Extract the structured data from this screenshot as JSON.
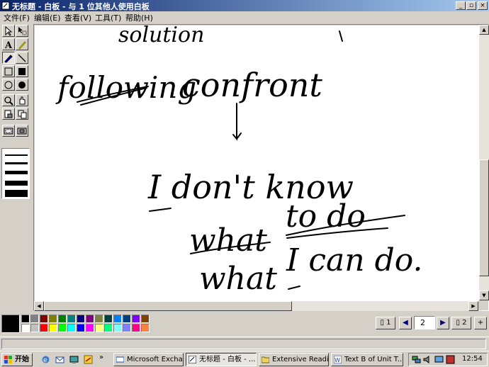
{
  "window": {
    "title": "无标题 - 白板 - 与 1 位其他人使用白板",
    "buttons": {
      "minimize": "_",
      "restore": "▫",
      "close": "×"
    }
  },
  "menu": [
    "文件(F)",
    "编辑(E)",
    "查看(V)",
    "工具(T)",
    "帮助(H)"
  ],
  "tools": [
    "select-arrow-icon",
    "zoom-select-icon",
    "text-tool-icon",
    "highlighter-icon",
    "pen-icon",
    "line-tool-icon",
    "unfilled-rectangle-icon",
    "filled-rectangle-icon",
    "unfilled-ellipse-icon",
    "filled-ellipse-icon",
    "zoom-icon",
    "remote-pointer-icon",
    "eraser-icon",
    "select-window-icon",
    "select-area-icon",
    "lock-contents-icon"
  ],
  "tool_labels": {
    "text": "A"
  },
  "line_widths": [
    2,
    3,
    5,
    7,
    10
  ],
  "current_color": "#000000",
  "palette": [
    "#000000",
    "#808080",
    "#800000",
    "#808000",
    "#008000",
    "#008080",
    "#000080",
    "#800080",
    "#808040",
    "#004040",
    "#0080ff",
    "#004080",
    "#8000ff",
    "#804000",
    "#ffffff",
    "#c0c0c0",
    "#ff0000",
    "#ffff00",
    "#00ff00",
    "#00ffff",
    "#0000ff",
    "#ff00ff",
    "#ffff80",
    "#00ff80",
    "#80ffff",
    "#8080ff",
    "#ff0080",
    "#ff8040"
  ],
  "handwriting": {
    "line1": "solution",
    "line2a": "following",
    "line2b": "confront",
    "line3": "I don't know",
    "line4a": "what",
    "line4b": "to do",
    "line5a": "what",
    "line5b": "I can do."
  },
  "page_nav": {
    "first_page": "1",
    "current_page": "2",
    "last_page": "2"
  },
  "taskbar": {
    "start": "开始",
    "overflow": "»",
    "tasks": [
      {
        "label": "Microsoft Excha...",
        "active": false
      },
      {
        "label": "无标题 - 白板 - ...",
        "active": true
      },
      {
        "label": "Extensive Reading",
        "active": false
      },
      {
        "label": "Text B of Unit T...",
        "active": false
      }
    ],
    "clock": "12:54"
  },
  "colors": {
    "titlebar_start": "#0a246a",
    "titlebar_end": "#a6caf0",
    "face": "#d4d0c8"
  }
}
